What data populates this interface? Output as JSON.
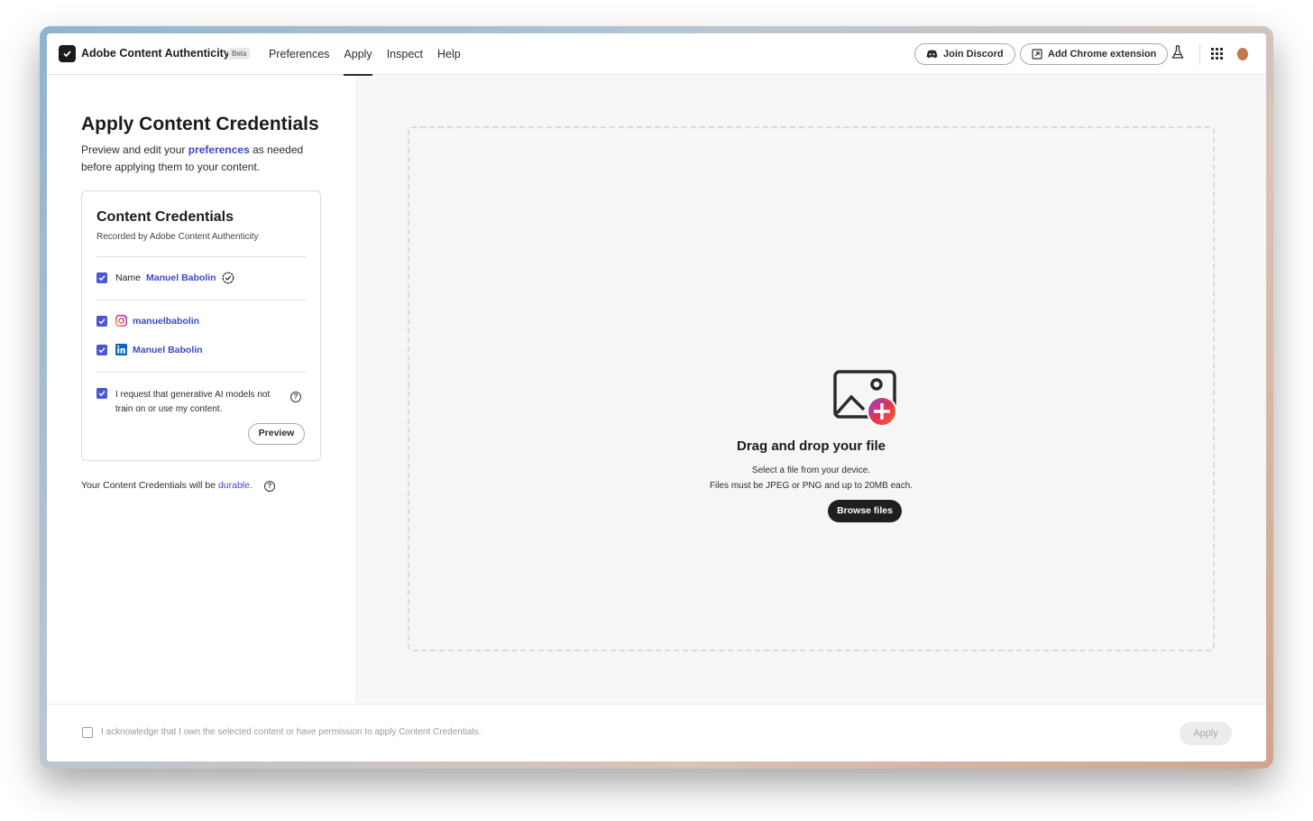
{
  "header": {
    "brand": "Adobe Content Authenticity",
    "beta": "Beta",
    "nav": [
      "Preferences",
      "Apply",
      "Inspect",
      "Help"
    ],
    "active_nav": "Apply",
    "join_discord": "Join Discord",
    "add_chrome_extension": "Add Chrome extension"
  },
  "left": {
    "title": "Apply Content Credentials",
    "intro_before": "Preview and edit your ",
    "intro_link": "preferences",
    "intro_after": " as needed before applying them to your content.",
    "card": {
      "title": "Content Credentials",
      "subtitle": "Recorded by Adobe Content Authenticity",
      "name_label": "Name",
      "name_value": "Manuel Babolin",
      "instagram": "manuelbabolin",
      "linkedin": "Manuel Babolin",
      "ai_request": "I request that generative AI models not train on or use my content.",
      "preview": "Preview"
    },
    "durable_before": "Your Content Credentials will be ",
    "durable_link": "durable."
  },
  "dropzone": {
    "title": "Drag and drop your file",
    "line1": "Select a file from your device.",
    "line2": "Files must be JPEG or PNG and up to 20MB each.",
    "browse": "Browse files"
  },
  "footer": {
    "acknowledge": "I acknowledge that I own the selected content or have permission to apply Content Credentials.",
    "apply": "Apply"
  },
  "colors": {
    "accent": "#4b55d6",
    "link": "#3b48c9",
    "dark_button": "#1f1f1f"
  }
}
